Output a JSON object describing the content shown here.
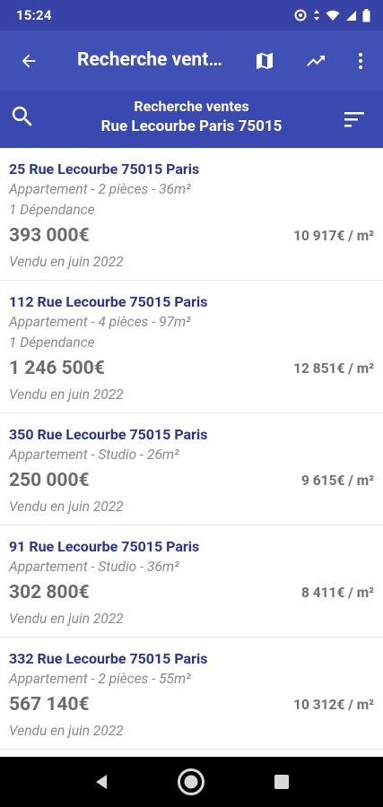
{
  "status": {
    "time": "15:24",
    "icons": [
      "alarm-icon",
      "data-arrows-icon",
      "wifi-icon",
      "signal-icon",
      "battery-icon"
    ]
  },
  "app_bar": {
    "title": "Recherche ventes",
    "actions": [
      "map-icon",
      "trending-up-icon",
      "more-vert-icon"
    ]
  },
  "search": {
    "line1": "Recherche ventes",
    "line2": "Rue Lecourbe Paris 75015"
  },
  "listings": [
    {
      "address": "25 Rue Lecourbe 75015 Paris",
      "desc": "Appartement - 2 pièces - 36m²",
      "extra": "1 Dépendance",
      "price": "393 000€",
      "ppm": "10 917€ / m²",
      "sold": "Vendu en juin 2022"
    },
    {
      "address": "112 Rue Lecourbe 75015 Paris",
      "desc": "Appartement - 4 pièces - 97m²",
      "extra": "1 Dépendance",
      "price": "1 246 500€",
      "ppm": "12 851€ / m²",
      "sold": "Vendu en juin 2022"
    },
    {
      "address": "350 Rue Lecourbe 75015 Paris",
      "desc": "Appartement - Studio - 26m²",
      "price": "250 000€",
      "ppm": "9 615€ / m²",
      "sold": "Vendu en juin 2022"
    },
    {
      "address": "91 Rue Lecourbe 75015 Paris",
      "desc": "Appartement - Studio - 36m²",
      "price": "302 800€",
      "ppm": "8 411€ / m²",
      "sold": "Vendu en juin 2022"
    },
    {
      "address": "332 Rue Lecourbe 75015 Paris",
      "desc": "Appartement - 2 pièces - 55m²",
      "price": "567 140€",
      "ppm": "10 312€ / m²",
      "sold": "Vendu en juin 2022"
    }
  ],
  "colors": {
    "app_bar": "#3f51b5",
    "status_bar": "#3843a7",
    "address": "#2a3597"
  }
}
